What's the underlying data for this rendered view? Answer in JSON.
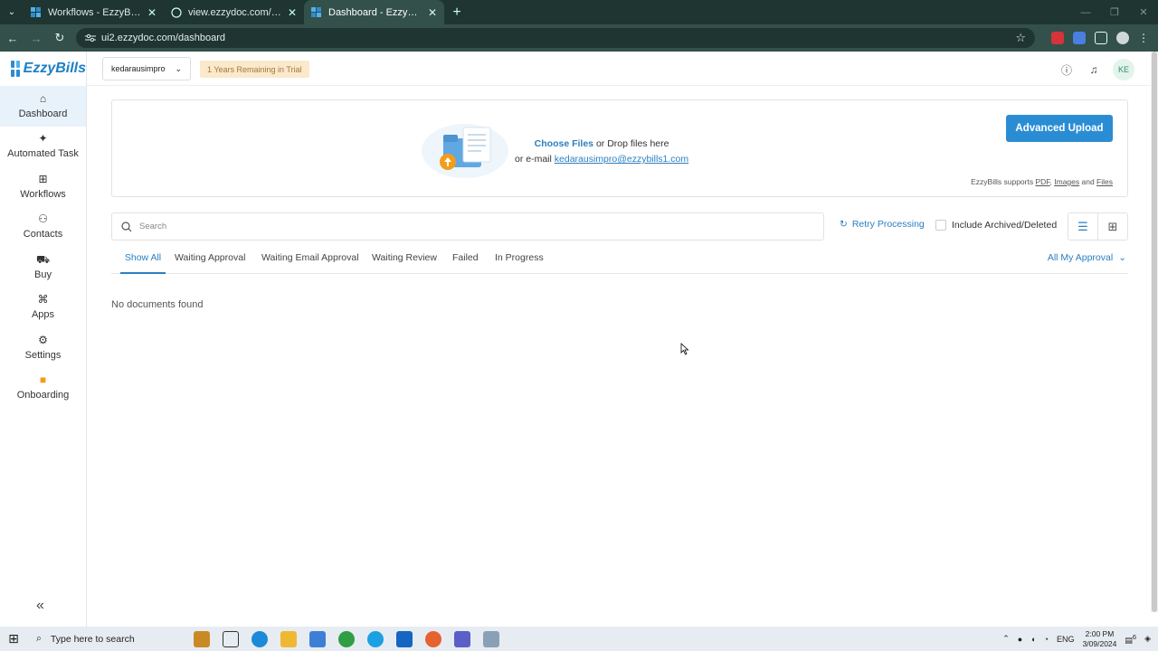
{
  "browser": {
    "tabs": [
      {
        "title": "Workflows - EzzyBills",
        "active": false
      },
      {
        "title": "view.ezzydoc.com/Approve.asp",
        "active": false
      },
      {
        "title": "Dashboard - EzzyBills",
        "active": true
      }
    ],
    "url": "ui2.ezzydoc.com/dashboard"
  },
  "app": {
    "logo_text": "EzzyBills",
    "sidebar": [
      {
        "label": "Dashboard",
        "icon": "home-icon",
        "active": true
      },
      {
        "label": "Automated Task",
        "icon": "sparkle-icon",
        "active": false
      },
      {
        "label": "Workflows",
        "icon": "workflow-icon",
        "active": false
      },
      {
        "label": "Contacts",
        "icon": "contacts-icon",
        "active": false
      },
      {
        "label": "Buy",
        "icon": "cart-icon",
        "active": false
      },
      {
        "label": "Apps",
        "icon": "apps-icon",
        "active": false
      },
      {
        "label": "Settings",
        "icon": "gear-icon",
        "active": false
      },
      {
        "label": "Onboarding",
        "icon": "video-icon",
        "active": false
      }
    ],
    "company_select": "kedarausimpro",
    "trial_badge": "1 Years Remaining in Trial",
    "avatar_initials": "KE",
    "upload": {
      "choose_files": "Choose Files",
      "drop_text": " or Drop files here",
      "email_prefix": "or e-mail ",
      "email": "kedarausimpro@ezzybills1.com",
      "advanced_button": "Advanced Upload",
      "supports_prefix": "EzzyBills supports ",
      "pdf": "PDF",
      "images": "Images",
      "and": " and ",
      "files": "Files"
    },
    "search_placeholder": "Search",
    "retry_processing": "Retry Processing",
    "include_archived": "Include Archived/Deleted",
    "filter_tabs": [
      {
        "label": "Show All",
        "active": true
      },
      {
        "label": "Waiting Approval",
        "active": false
      },
      {
        "label": "Waiting Email Approval",
        "active": false
      },
      {
        "label": "Waiting Review",
        "active": false
      },
      {
        "label": "Failed",
        "active": false
      },
      {
        "label": "In Progress",
        "active": false
      }
    ],
    "approval_filter": "All My Approval",
    "empty_message": "No documents found"
  },
  "taskbar": {
    "search_placeholder": "Type here to search",
    "language": "ENG",
    "time": "2:00 PM",
    "date": "3/09/2024",
    "notifications": "6"
  },
  "colors": {
    "accent": "#2a8dd4",
    "chrome_dark": "#1f3531",
    "chrome": "#33504b",
    "trial_bg": "#fbe9cc"
  }
}
